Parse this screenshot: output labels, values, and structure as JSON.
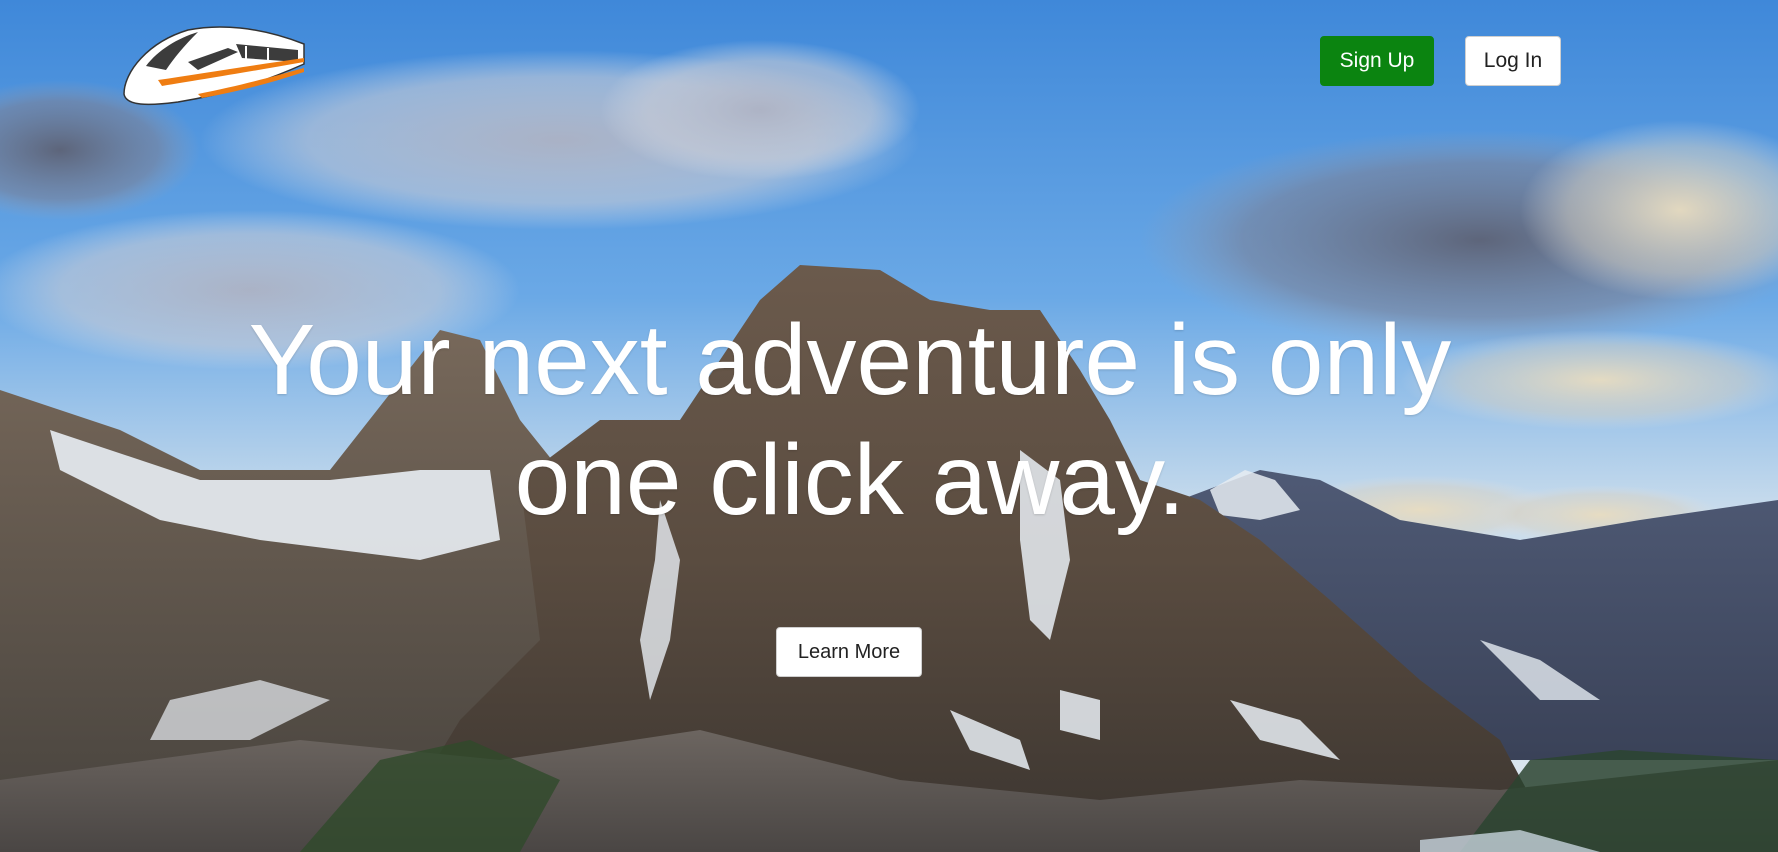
{
  "header": {
    "logo_icon": "high-speed-train-icon",
    "signup_label": "Sign Up",
    "login_label": "Log In"
  },
  "hero": {
    "background": "mountain-landscape-image",
    "headline_line1": "Your next adventure is only",
    "headline_line2": "one click away.",
    "learn_more_label": "Learn More"
  },
  "colors": {
    "signup_bg": "#0b8410",
    "text_white": "#ffffff",
    "button_white": "#ffffff"
  }
}
